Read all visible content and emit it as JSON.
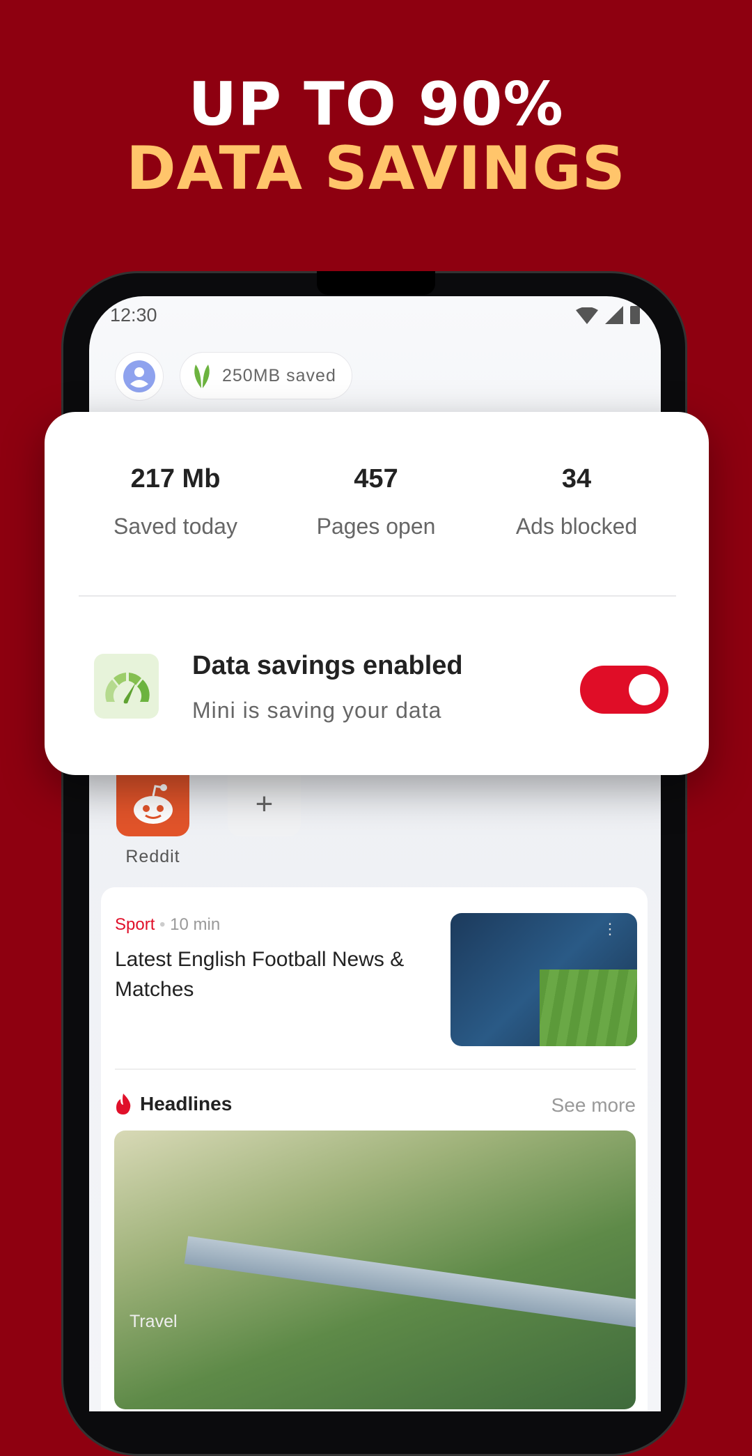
{
  "headline": {
    "line1": "UP TO 90%",
    "line2": "DATA SAVINGS"
  },
  "status_bar": {
    "time": "12:30"
  },
  "top_bar": {
    "savings_pill": "250MB saved"
  },
  "stats": [
    {
      "value": "217 Mb",
      "label": "Saved today"
    },
    {
      "value": "457",
      "label": "Pages open"
    },
    {
      "value": "34",
      "label": "Ads blocked"
    }
  ],
  "data_savings": {
    "title": "Data savings enabled",
    "subtitle": "Mini is saving your data",
    "enabled": true
  },
  "speed_dial": [
    {
      "label": "Reddit",
      "icon": "reddit-icon"
    },
    {
      "label": "",
      "icon": "plus-icon"
    }
  ],
  "plus_glyph": "+",
  "news": {
    "category": "Sport",
    "separator": "•",
    "age": "10 min",
    "title": "Latest English Football News & Matches",
    "menu_glyph": "⋮"
  },
  "headlines": {
    "title": "Headlines",
    "see_more": "See more",
    "image_tag": "Travel"
  },
  "colors": {
    "background": "#8e0010",
    "accent": "#ffc56b",
    "toggle": "#e00d27"
  }
}
